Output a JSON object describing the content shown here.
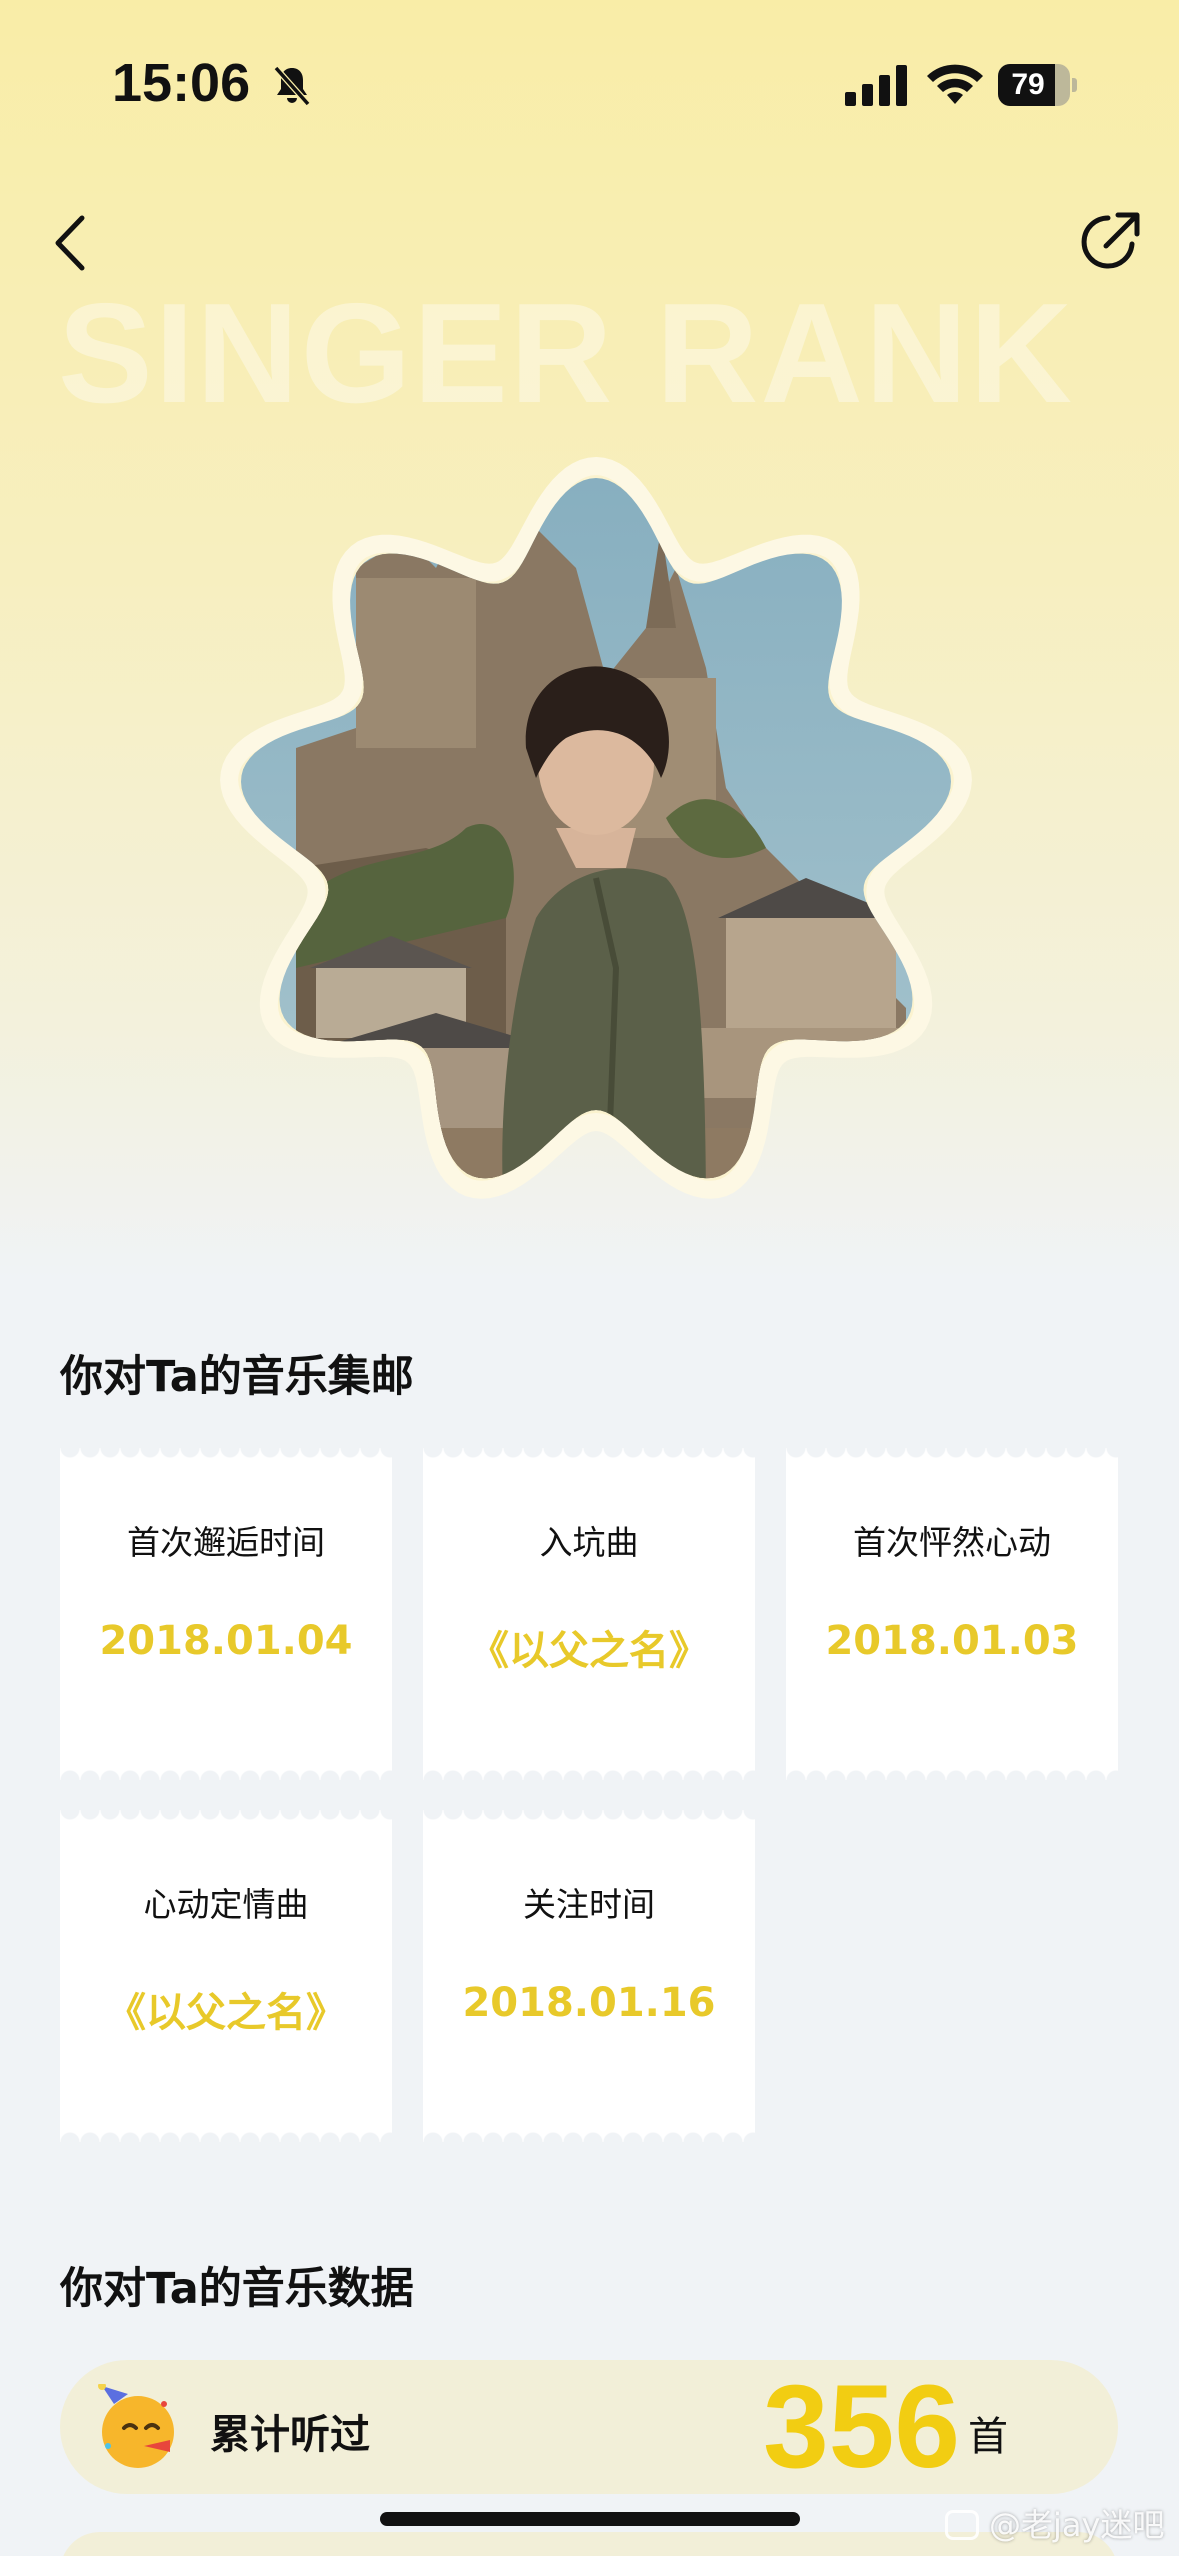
{
  "status_bar": {
    "time": "15:06",
    "battery": "79",
    "battery_level": 0.79
  },
  "header": {
    "watermark": "SINGER RANK"
  },
  "sections": {
    "collection_title": "你对Ta的音乐集邮",
    "data_title": "你对Ta的音乐数据"
  },
  "stamps": [
    {
      "label": "首次邂逅时间",
      "value": "2018.01.04"
    },
    {
      "label": "入坑曲",
      "value": "《以父之名》"
    },
    {
      "label": "首次怦然心动",
      "value": "2018.01.03"
    },
    {
      "label": "心动定情曲",
      "value": "《以父之名》"
    },
    {
      "label": "关注时间",
      "value": "2018.01.16"
    }
  ],
  "stats": {
    "listened_label": "累计听过",
    "listened_value": "356",
    "listened_unit": "首",
    "emoji": "partying-face"
  },
  "watermark": {
    "text": "@老jay迷吧"
  },
  "colors": {
    "accent_yellow": "#e8c92a",
    "background": "#f0f3f6",
    "hero_top": "#f9eda7"
  }
}
